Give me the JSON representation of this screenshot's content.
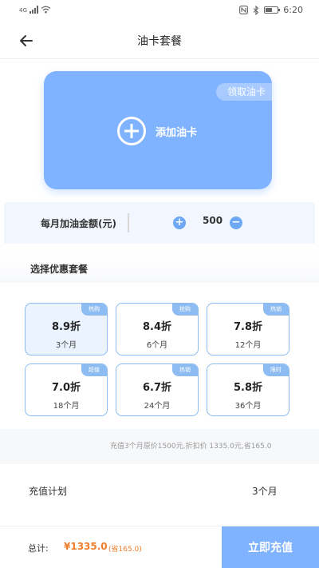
{
  "status_bar": {
    "carrier": "4G",
    "time": "6:20"
  },
  "nav": {
    "title": "油卡套餐"
  },
  "card": {
    "get_card_label": "领取油卡",
    "add_card_label": "添加油卡"
  },
  "amount": {
    "label": "每月加油金额(元)",
    "value": "500",
    "plus": "+",
    "minus": "−"
  },
  "section": {
    "title": "选择优惠套餐"
  },
  "packages": [
    {
      "tag": "热购",
      "discount": "8.9折",
      "months": "3个月",
      "selected": true
    },
    {
      "tag": "抢购",
      "discount": "8.4折",
      "months": "6个月",
      "selected": false
    },
    {
      "tag": "热销",
      "discount": "7.8折",
      "months": "12个月",
      "selected": false
    },
    {
      "tag": "超值",
      "discount": "7.0折",
      "months": "18个月",
      "selected": false
    },
    {
      "tag": "热销",
      "discount": "6.7折",
      "months": "24个月",
      "selected": false
    },
    {
      "tag": "限时",
      "discount": "5.8折",
      "months": "36个月",
      "selected": false
    }
  ],
  "note": "充值3个月原价1500元,折扣价  1335.0元,省165.0",
  "plan": {
    "label": "充值计划",
    "value": "3个月"
  },
  "footer": {
    "total_label": "总计:",
    "total_price": "¥1335.0",
    "save": "(省165.0)",
    "submit_label": "立即充值"
  },
  "colors": {
    "accent": "#80b3ff",
    "price": "#f07d2c",
    "border": "#8cbcf2"
  }
}
